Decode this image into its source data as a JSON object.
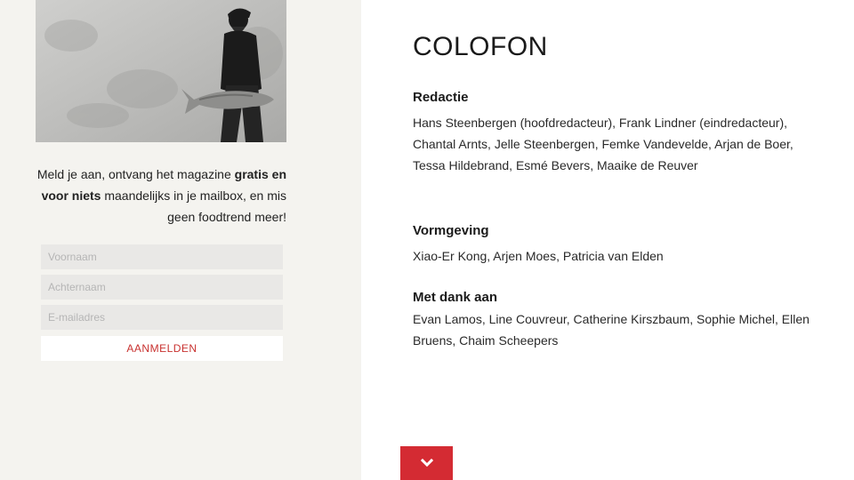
{
  "signup": {
    "promo_prefix": "Meld je aan, ontvang het magazine ",
    "promo_bold": "gratis en voor niets",
    "promo_suffix": " maandelijks in je mailbox, en mis geen foodtrend meer!",
    "first_name_placeholder": "Voornaam",
    "last_name_placeholder": "Achternaam",
    "email_placeholder": "E-mailadres",
    "submit_label": "AANMELDEN"
  },
  "colofon": {
    "title": "COLOFON",
    "sections": [
      {
        "heading": "Redactie",
        "text": "Hans Steenbergen (hoofdredacteur), Frank Lindner (eindredacteur), Chantal Arnts, Jelle Steenbergen, Femke Vandevelde, Arjan de Boer, Tessa Hildebrand, Esmé Bevers, Maaike de Reuver"
      },
      {
        "heading": "Vormgeving",
        "text": "Xiao-Er Kong, Arjen Moes, Patricia van Elden"
      },
      {
        "heading": "Met dank aan",
        "text": "Evan Lamos, Line Couvreur, Catherine Kirszbaum, Sophie Michel, Ellen Bruens, Chaim Scheepers"
      }
    ]
  },
  "icons": {
    "scroll_down": "chevron-down-icon"
  },
  "colors": {
    "accent": "#d42b33",
    "link_red": "#c8312f",
    "left_panel_bg": "#f4f3ef",
    "input_bg": "#e9e8e6"
  }
}
